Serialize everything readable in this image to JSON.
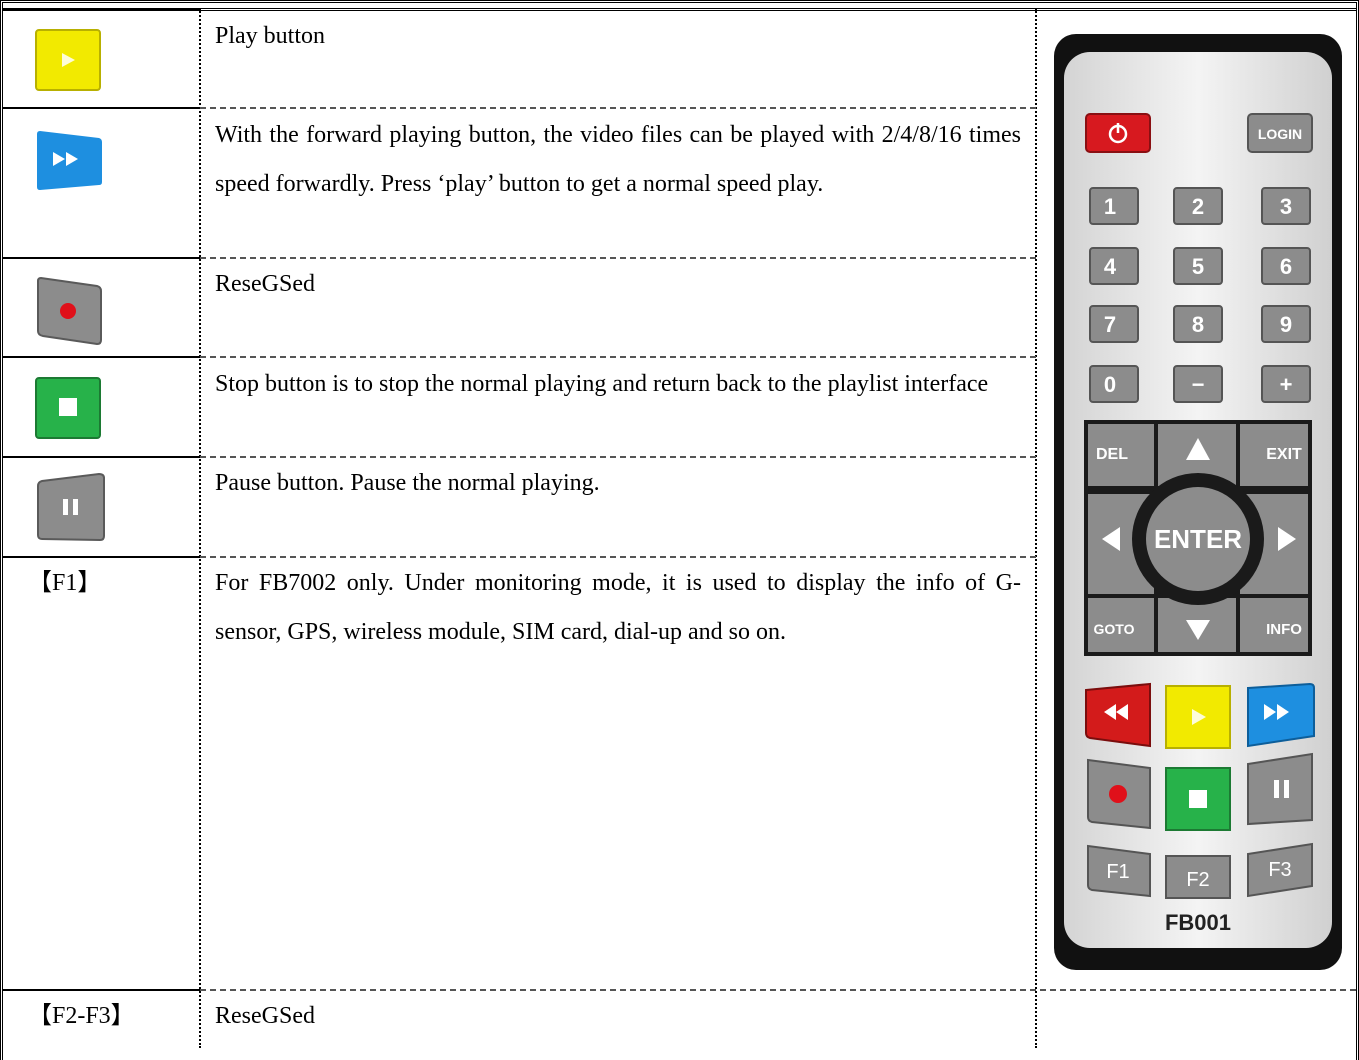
{
  "rows": [
    {
      "icon": "play-icon",
      "text": "Play button"
    },
    {
      "icon": "fast-forward-icon",
      "text": "With the forward playing button, the video files can be played with 2/4/8/16 times speed forwardly.  Press ‘play’ button to get a normal speed play."
    },
    {
      "icon": "record-icon",
      "text": "ReseGSed"
    },
    {
      "icon": "stop-icon",
      "text": "Stop button is to stop the normal playing and return back to the playlist interface"
    },
    {
      "icon": "pause-icon",
      "text": "Pause button. Pause the normal playing."
    },
    {
      "key": "【F1】",
      "text": "For FB7002 only. Under monitoring mode, it is used to display the info of G-sensor, GPS, wireless module, SIM card, dial-up and so on."
    },
    {
      "key": "【F2-F3】",
      "text": "ReseGSed"
    }
  ],
  "remote": {
    "login": "LOGIN",
    "digits": [
      "1",
      "2",
      "3",
      "4",
      "5",
      "6",
      "7",
      "8",
      "9",
      "0",
      "−",
      "+"
    ],
    "del": "DEL",
    "exit": "EXIT",
    "enter": "ENTER",
    "goto": "GOTO",
    "info": "INFO",
    "f1": "F1",
    "f2": "F2",
    "f3": "F3",
    "model": "FB001",
    "colors": {
      "power": "#d7191f",
      "rewind": "#d31b1b",
      "play": "#f2ea00",
      "ff": "#1e8fe0",
      "stop": "#27b24a",
      "key": "#8c8c8c"
    }
  }
}
